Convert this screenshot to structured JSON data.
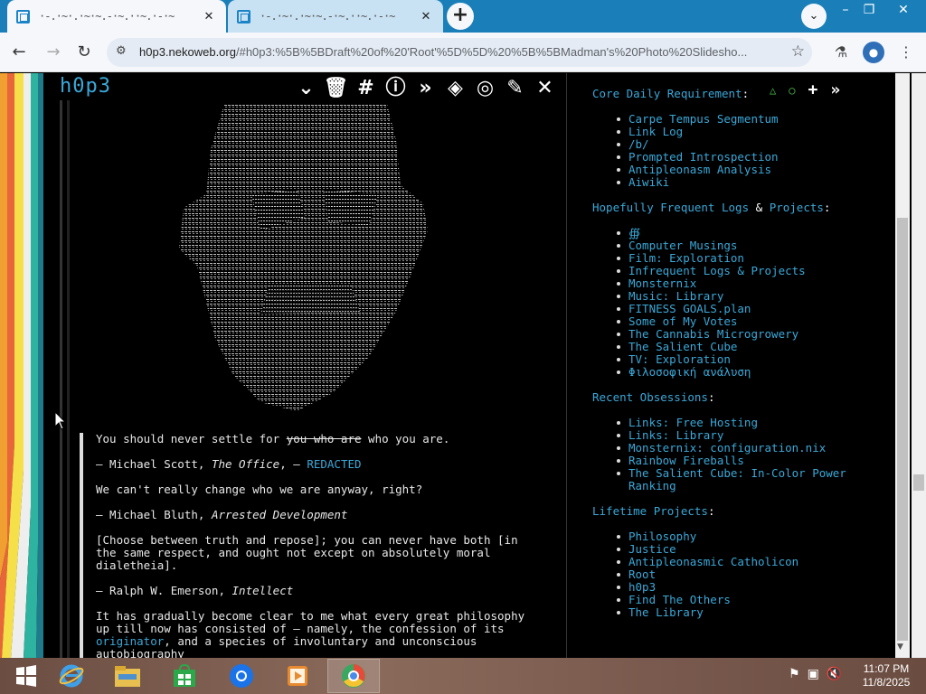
{
  "browser": {
    "tabs": [
      {
        "title": "·-.·~·.·~·~.-·~.··~.·-·~"
      },
      {
        "title": "·-.·~·.·~·~.-·~.··~.·-·~"
      }
    ],
    "new_tab": "+",
    "tab_search": "⌄",
    "window_controls": [
      "–",
      "❐",
      "✕"
    ],
    "nav": {
      "back": "←",
      "forward": "→",
      "reload": "↻"
    },
    "url_host": "h0p3.nekoweb.org",
    "url_path": "/#h0p3:%5B%5BDraft%20of%20'Root'%5D%5D%20%5B%5BMadman's%20Photo%20Slidesho...",
    "icons": {
      "site_info": "tune-icon",
      "star": "star-icon",
      "labs": "flask-icon",
      "profile": "profile-icon",
      "menu": "kebab-menu-icon"
    }
  },
  "left": {
    "logo": "h0p3",
    "toolbar": [
      "⌄",
      "🗑",
      "#",
      "ⓘ",
      "»",
      "◈",
      "◎",
      "✎",
      "✕"
    ],
    "quotes": [
      {
        "pre": "You should never settle for ",
        "strike": "you who are",
        "post": " who you are."
      },
      {
        "pre": "– Michael Scott, ",
        "ital": "The Office",
        "mid": ", – ",
        "link": "REDACTED"
      },
      {
        "text": "We can't really change who we are anyway, right?"
      },
      {
        "pre": "– Michael Bluth, ",
        "ital": "Arrested Development"
      },
      {
        "text": "[Choose between truth and repose]; you can never have both [in the same respect, and ought not except on absolutely moral dialetheia]."
      },
      {
        "pre": "– Ralph W. Emerson, ",
        "ital": "Intellect"
      },
      {
        "pre": "It has gradually become clear to me what every great philosophy up till now has consisted of – namely, the confession of its ",
        "link": "originator",
        "post": ", and a species of involuntary and unconscious autobiography"
      }
    ]
  },
  "right": {
    "icons": {
      "triangle": "△",
      "circle": "○",
      "plus": "+",
      "next": "»"
    },
    "sections": [
      {
        "head": "Core Daily Requirement",
        "items": [
          "Carpe Tempus Segmentum",
          "Link Log",
          "/b/",
          "Prompted Introspection",
          "Antipleonasm Analysis",
          "Aiwiki"
        ]
      },
      {
        "head_a": "Hopefully Frequent Logs",
        "head_amp": "&",
        "head_b": "Projects",
        "items": [
          "∰",
          "Computer Musings",
          "Film: Exploration",
          "Infrequent Logs & Projects",
          "Monsternix",
          "Music: Library",
          "FITNESS GOALS.plan",
          "Some of My Votes",
          "The Cannabis Microgrowery",
          "The Salient Cube",
          "TV: Exploration",
          "Φιλοσοφική ανάλυση"
        ]
      },
      {
        "head": "Recent Obsessions",
        "items": [
          "Links: Free Hosting",
          "Links: Library",
          "Monsternix: configuration.nix",
          "Rainbow Fireballs",
          "The Salient Cube: In-Color Power Ranking"
        ]
      },
      {
        "head": "Lifetime Projects",
        "items": [
          "Philosophy",
          "Justice",
          "Antipleonasmic Catholicon",
          "Root",
          "h0p3",
          "Find The Others",
          "The Library"
        ]
      }
    ]
  },
  "taskbar": {
    "apps": [
      "start-icon",
      "internet-explorer-icon",
      "file-explorer-icon",
      "store-icon",
      "chrome-icon",
      "media-player-icon",
      "chrome-alt-icon"
    ],
    "time": "11:07 PM",
    "date": "11/8/2025"
  }
}
